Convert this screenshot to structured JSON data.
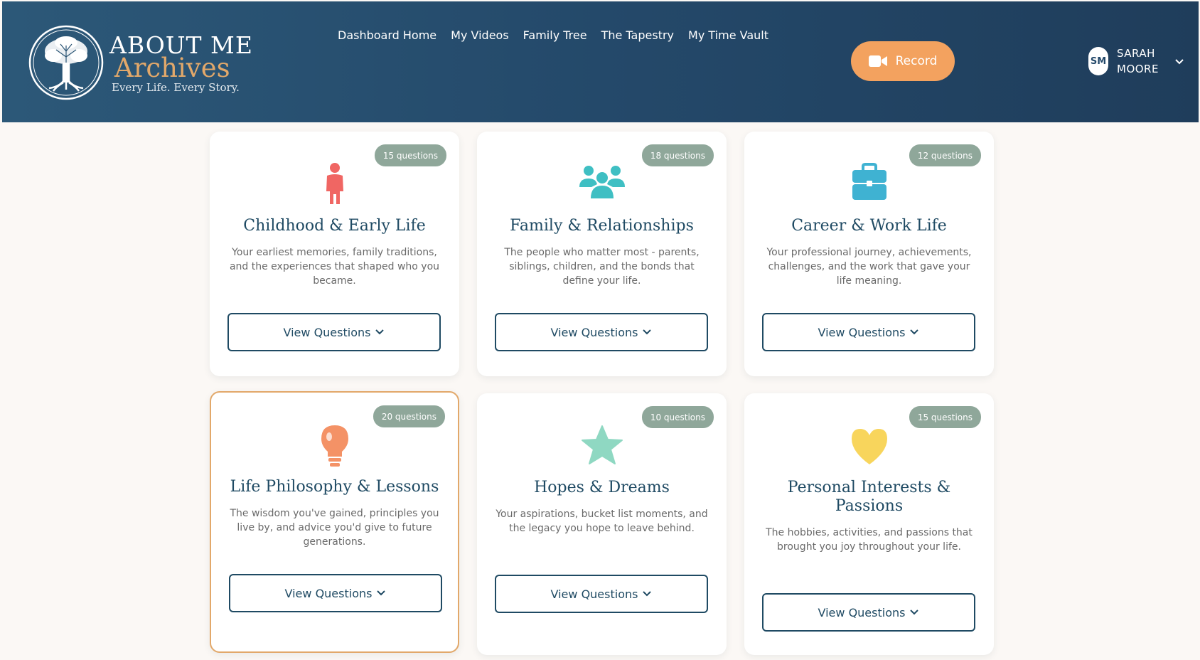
{
  "brand": {
    "name_line1": "ABOUT ME",
    "name_line2": "Archives",
    "tagline": "Every Life. Every Story."
  },
  "nav": {
    "items": [
      "Dashboard Home",
      "My Videos",
      "Family Tree",
      "The Tapestry",
      "My Time Vault"
    ]
  },
  "record_button": {
    "label": "Record",
    "icon": "video-camera-icon"
  },
  "user": {
    "initials": "SM",
    "first_name": "SARAH",
    "last_name": "MOORE"
  },
  "colors": {
    "header": "#24496a",
    "accent_orange": "#f3a25f",
    "badge": "#8fa79a",
    "title": "#1f4a63"
  },
  "cards": [
    {
      "badge": "15 questions",
      "icon": "child-icon",
      "icon_color": "#f06663",
      "title": "Childhood & Early Life",
      "description": "Your earliest memories, family traditions, and the experiences that shaped who you became.",
      "button": "View Questions"
    },
    {
      "badge": "18 questions",
      "icon": "people-icon",
      "icon_color": "#3fbfc3",
      "title": "Family & Relationships",
      "description": "The people who matter most - parents, siblings, children, and the bonds that define your life.",
      "button": "View Questions"
    },
    {
      "badge": "12 questions",
      "icon": "briefcase-icon",
      "icon_color": "#3fb2d2",
      "title": "Career & Work Life",
      "description": "Your professional journey, achievements, challenges, and the work that gave your life meaning.",
      "button": "View Questions"
    },
    {
      "badge": "20 questions",
      "icon": "lightbulb-icon",
      "icon_color": "#f49266",
      "title": "Life Philosophy & Lessons",
      "description": "The wisdom you've gained, principles you live by, and advice you'd give to future generations.",
      "button": "View Questions"
    },
    {
      "badge": "10 questions",
      "icon": "star-icon",
      "icon_color": "#8fd8c2",
      "title": "Hopes & Dreams",
      "description": "Your aspirations, bucket list moments, and the legacy you hope to leave behind.",
      "button": "View Questions"
    },
    {
      "badge": "15 questions",
      "icon": "heart-icon",
      "icon_color": "#f8d55c",
      "title": "Personal Interests & Passions",
      "description": "The hobbies, activities, and passions that brought you joy throughout your life.",
      "button": "View Questions"
    }
  ]
}
